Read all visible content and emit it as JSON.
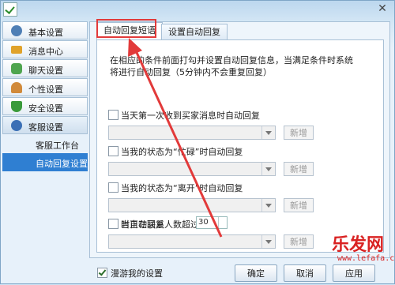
{
  "sidebar": {
    "items": [
      {
        "label": "基本设置",
        "icon": "gear-icon",
        "color": "#4f7fb5"
      },
      {
        "label": "消息中心",
        "icon": "envelope-icon",
        "color": "#e0a22a"
      },
      {
        "label": "聊天设置",
        "icon": "chat-icon",
        "color": "#4fa54f"
      },
      {
        "label": "个性设置",
        "icon": "person-icon",
        "color": "#d18a3a"
      },
      {
        "label": "安全设置",
        "icon": "shield-icon",
        "color": "#3a9a3a"
      },
      {
        "label": "客服设置",
        "icon": "headset-icon",
        "color": "#3a6fb5"
      }
    ],
    "subitems": [
      {
        "label": "客服工作台"
      },
      {
        "label": "自动回复设置"
      }
    ]
  },
  "tabs": [
    {
      "label": "自动回复短语"
    },
    {
      "label": "设置自动回复"
    }
  ],
  "content": {
    "description": "在相应的条件前面打勾并设置自动回复信息，当满足条件时系统将进行自动回复（5分钟内不会重复回复）",
    "rules": [
      {
        "label": "当天第一次收到买家消息时自动回复",
        "add_label": "新增"
      },
      {
        "label": "当我的状态为“忙碌”时自动回复",
        "add_label": "新增"
      },
      {
        "label": "当我的状态为“离开”时自动回复",
        "add_label": "新增"
      },
      {
        "label": "当正在联系人数超过",
        "spin_value": "30",
        "label_after": "时自动回复",
        "add_label": "新增"
      }
    ]
  },
  "footer": {
    "roam_label": "漫游我的设置",
    "ok_label": "确定",
    "cancel_label": "取消",
    "apply_label": "应用"
  },
  "watermark": {
    "text": "乐发网",
    "url": "www.lefafa.cn"
  },
  "colors": {
    "highlight": "#e23a3a",
    "selected": "#2f7fd2"
  }
}
